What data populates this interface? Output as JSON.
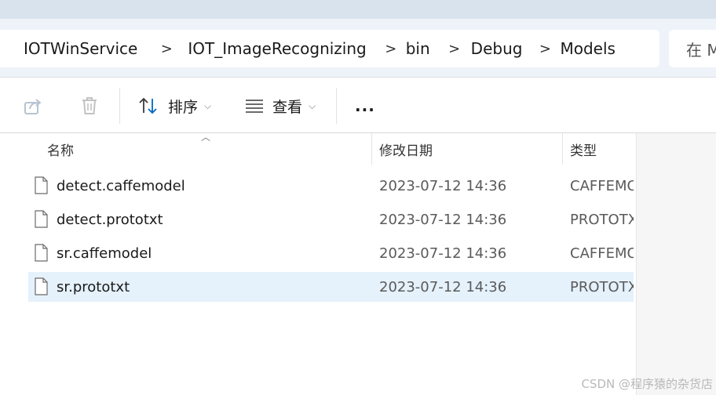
{
  "breadcrumb": [
    {
      "label": "IOTWinService"
    },
    {
      "label": "IOT_ImageRecognizing"
    },
    {
      "label": "bin"
    },
    {
      "label": "Debug"
    },
    {
      "label": "Models"
    }
  ],
  "separator": ">",
  "search": {
    "placeholder": "在 M"
  },
  "toolbar": {
    "share_icon": "share-icon",
    "delete_icon": "trash-icon",
    "sort_label": "排序",
    "view_label": "查看",
    "more_label": "..."
  },
  "columns": {
    "name": "名称",
    "date": "修改日期",
    "type": "类型"
  },
  "files": [
    {
      "name": "detect.caffemodel",
      "date": "2023-07-12 14:36",
      "type": "CAFFEMODEL"
    },
    {
      "name": "detect.prototxt",
      "date": "2023-07-12 14:36",
      "type": "PROTOTXT"
    },
    {
      "name": "sr.caffemodel",
      "date": "2023-07-12 14:36",
      "type": "CAFFEMODEL"
    },
    {
      "name": "sr.prototxt",
      "date": "2023-07-12 14:36",
      "type": "PROTOTXT"
    }
  ],
  "selected_index": 3,
  "watermark": "CSDN @程序猿的杂货店",
  "colors": {
    "selection": "#e5f1fb",
    "accent": "#0067c0"
  }
}
